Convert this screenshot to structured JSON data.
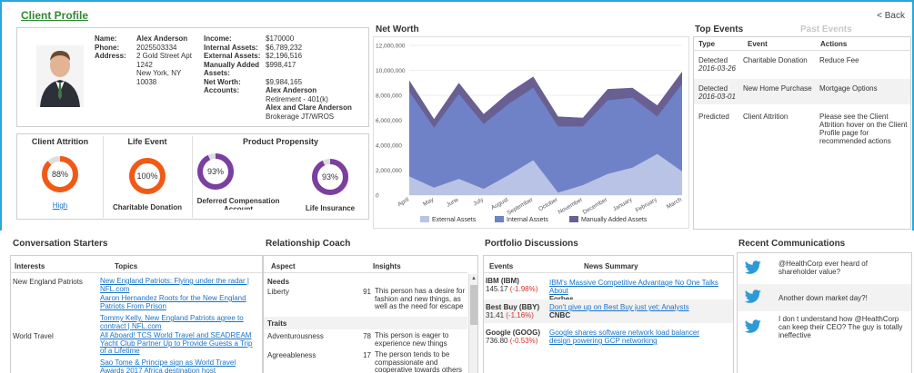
{
  "header": {
    "title": "Client Profile",
    "back_label": "< Back"
  },
  "profile": {
    "name_label": "Name:",
    "name": "Alex Anderson",
    "phone_label": "Phone:",
    "phone": "2025503334",
    "address_label": "Address:",
    "address_line1": "2 Gold Street Apt",
    "address_line2": "1242",
    "address_line3": "New York, NY",
    "address_line4": "10038",
    "income_label": "Income:",
    "income": "$170000",
    "internal_label": "Internal Assets:",
    "internal": "$6,789,232",
    "external_label": "External Assets:",
    "external": "$2,196,516",
    "manual_label_1": "Manually Added",
    "manual_label_2": "Assets:",
    "manual": "$998,417",
    "networth_label": "Net Worth:",
    "networth": "$9,984,165",
    "accounts_label": "Accounts:",
    "account1_name": "Alex Anderson",
    "account1_type": "Retirement - 401(k)",
    "account2_name": "Alex and Clare Anderson",
    "account2_type": "Brokerage JT/WROS"
  },
  "gauges": {
    "attrition_title": "Client Attrition",
    "attrition_value": "88%",
    "attrition_level": 0.88,
    "attrition_link": "High",
    "life_title": "Life Event",
    "life_value": "100%",
    "life_level": 1.0,
    "life_caption": "Charitable Donation",
    "propensity_title": "Product Propensity",
    "deferred_value": "93%",
    "deferred_level": 0.93,
    "deferred_caption_1": "Deferred Compensation",
    "deferred_caption_2": "Account",
    "life_ins_value": "93%",
    "life_ins_level": 0.93,
    "life_ins_caption": "Life Insurance",
    "orange": "#f05a16",
    "purple": "#7b3fa0",
    "track": "#dedede"
  },
  "chart_data": {
    "type": "area",
    "title": "Net Worth",
    "categories": [
      "April",
      "May",
      "June",
      "July",
      "August",
      "September",
      "October",
      "November",
      "December",
      "January",
      "February",
      "March"
    ],
    "ylim": [
      0,
      12000000
    ],
    "yticks": [
      "0",
      "2,000,000",
      "4,000,000",
      "6,000,000",
      "8,000,000",
      "10,000,000",
      "12,000,000"
    ],
    "stacked": true,
    "series": [
      {
        "name": "External Assets",
        "color": "#b9c3e6",
        "values": [
          1500000,
          600000,
          1300000,
          500000,
          1600000,
          2800000,
          200000,
          800000,
          1700000,
          2200000,
          3300000,
          1900000
        ]
      },
      {
        "name": "Internal Assets",
        "color": "#6f82c7",
        "values": [
          6800000,
          4800000,
          6800000,
          5200000,
          5700000,
          5800000,
          5300000,
          4700000,
          5900000,
          5600000,
          3000000,
          7000000
        ]
      },
      {
        "name": "Manually Added Assets",
        "color": "#6a5f93",
        "values": [
          900000,
          700000,
          900000,
          800000,
          900000,
          900000,
          800000,
          700000,
          900000,
          800000,
          900000,
          1000000
        ]
      }
    ],
    "legend": "bottom"
  },
  "top_events": {
    "tab_active": "Top Events",
    "tab_inactive": "Past Events",
    "headers": [
      "Type",
      "Event",
      "Actions"
    ],
    "rows": [
      {
        "type1": "Detected",
        "type2": "2016-03-26",
        "event": "Charitable Donation",
        "action": "Reduce Fee"
      },
      {
        "type1": "Detected",
        "type2": "2016-03-01",
        "event": "New Home Purchase",
        "action": "Mortgage Options"
      },
      {
        "type1": "Predicted",
        "type2": "",
        "event": "Client Attrition",
        "action": "Please see the Client Attrition hover on the Client Profile page for recommended actions"
      }
    ]
  },
  "conversation": {
    "title": "Conversation Starters",
    "headers": [
      "Interests",
      "Topics"
    ],
    "rows": [
      {
        "interest": "New England Patriots",
        "topics": [
          "New England Patriots: Flying under the radar | NFL.com",
          "Aaron Hernandez Roots for the New England Patriots From Prison",
          "Tommy Kelly, New England Patriots agree to contract | NFL.com"
        ]
      },
      {
        "interest": "World Travel",
        "topics": [
          "All Aboard! TCS World Travel and SEADREAM Yacht Club Partner Up to Provide Guests a Trip of a Lifetime",
          "Sao Tome & Principe sign as World Travel Awards 2017 Africa destination host"
        ]
      }
    ]
  },
  "coach": {
    "title": "Relationship Coach",
    "headers": [
      "Aspect",
      "Insights"
    ],
    "needs_label": "Needs",
    "traits_label": "Traits",
    "needs": [
      {
        "aspect": "Liberty",
        "score": "91",
        "insight": "This person has a desire for fashion and new things, as well as the need for escape"
      }
    ],
    "traits": [
      {
        "aspect": "Adventurousness",
        "score": "78",
        "insight": "This person is eager to experience new things"
      },
      {
        "aspect": "Agreeableness",
        "score": "17",
        "insight": "The person tends to be compassionate and cooperative towards others"
      }
    ]
  },
  "portfolio": {
    "title": "Portfolio Discussions",
    "headers": [
      "Events",
      "News Summary"
    ],
    "rows": [
      {
        "name": "IBM (IBM)",
        "price": "145.17",
        "change": "(-1.98%)",
        "news": "IBM's Massive Competitive Advantage No One Talks About",
        "source": "Forbes"
      },
      {
        "name": "Best Buy (BBY)",
        "price": "31.41",
        "change": "(-1.16%)",
        "news": "Don't give up on Best Buy just yet: Analysts",
        "source": "CNBC"
      },
      {
        "name": "Google (GOOG)",
        "price": "736.80",
        "change": "(-0.53%)",
        "news": "Google shares software network load balancer design powering GCP networking",
        "source": ""
      }
    ]
  },
  "communications": {
    "title": "Recent Communications",
    "items": [
      "@HealthCorp ever heard of shareholder value?",
      "Another down market day?!",
      "I don t understand how @HealthCorp can keep their CEO? The guy is totally ineffective"
    ]
  }
}
